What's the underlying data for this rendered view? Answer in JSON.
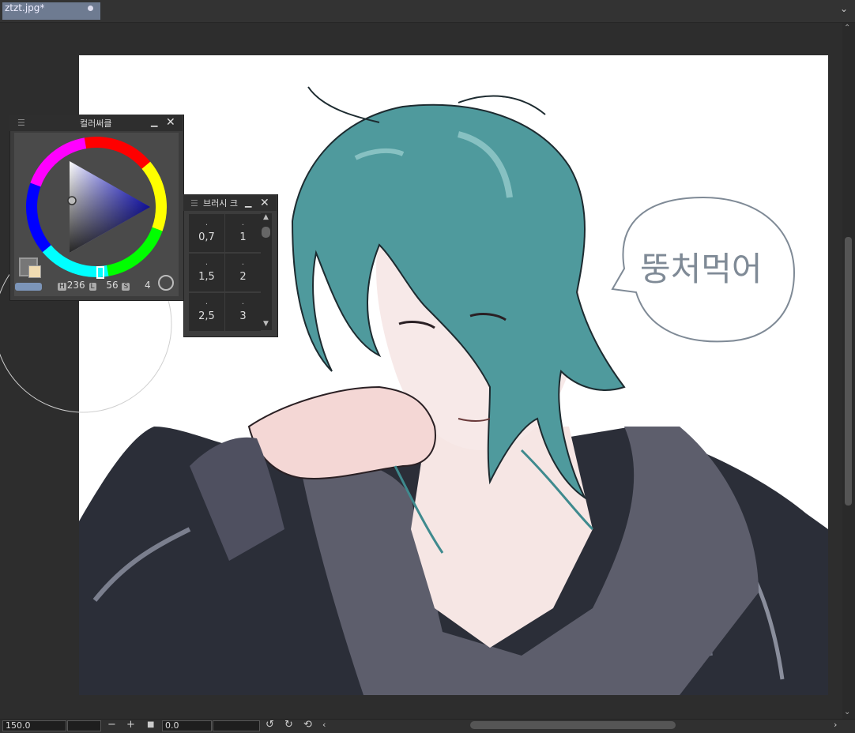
{
  "tab": {
    "title": "ztzt.jpg*"
  },
  "tab_menu_icon": "chevron-down-icon",
  "speech_bubble_text": "뚱처먹어",
  "color_panel": {
    "title": "컬러써클",
    "readout": {
      "h_label": "H",
      "h_value": "236",
      "l_label": "L",
      "l_value": "56",
      "s_label": "S",
      "s_value": "4"
    }
  },
  "brush_panel": {
    "title": "브러시 크",
    "sizes": [
      "0,7",
      "1",
      "1,5",
      "2",
      "2,5",
      "3"
    ]
  },
  "bottom_bar": {
    "zoom": "150.0",
    "minus": "−",
    "plus": "+",
    "stop": "■",
    "rotation": "0.0"
  },
  "colors": {
    "hair": "#4f9a9d",
    "jacket": "#2b2e38",
    "shirt": "#5d5e6c",
    "skin": "#f6e6e4",
    "tab_bg": "#6e7b91"
  }
}
